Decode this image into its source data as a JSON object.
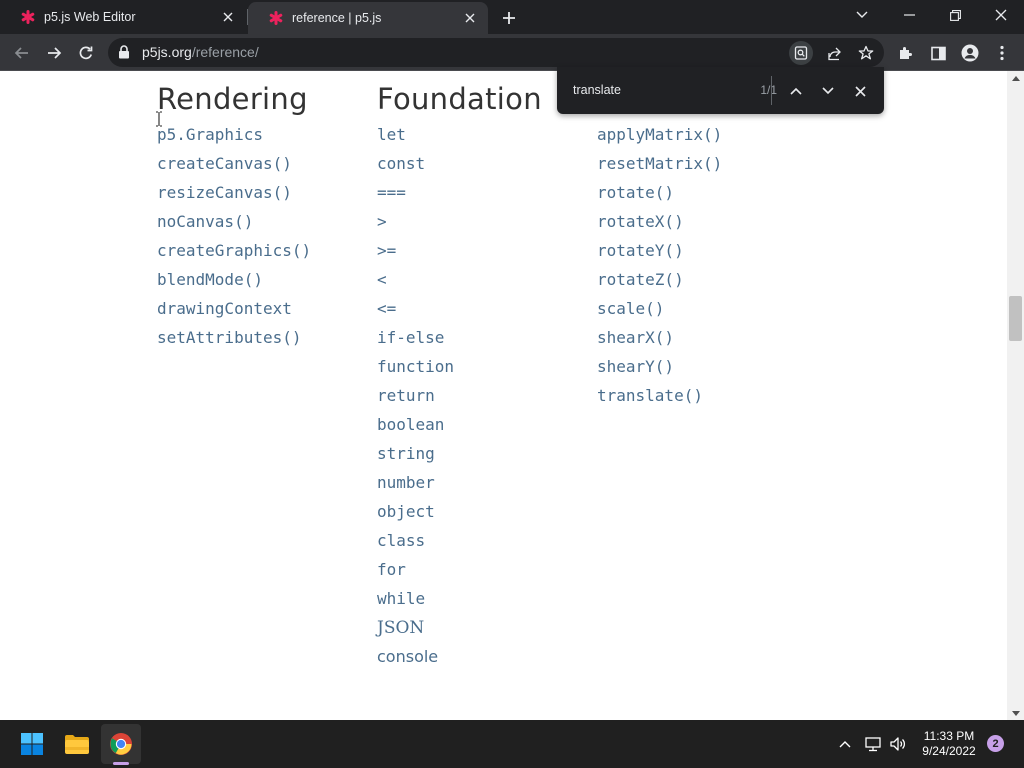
{
  "browser": {
    "tabs": [
      {
        "title": "p5.js Web Editor",
        "active": false,
        "favicon": "p5-asterisk-icon"
      },
      {
        "title": "reference | p5.js",
        "active": true,
        "favicon": "p5-asterisk-icon"
      }
    ],
    "url": {
      "domain": "p5js.org",
      "path": "/reference/"
    },
    "accent": "#ed225d"
  },
  "find_bar": {
    "query": "translate",
    "count": "1/1"
  },
  "page": {
    "columns": [
      {
        "heading": "Rendering",
        "items": [
          "p5.Graphics",
          "createCanvas()",
          "resizeCanvas()",
          "noCanvas()",
          "createGraphics()",
          "blendMode()",
          "drawingContext",
          "setAttributes()"
        ]
      },
      {
        "heading": "Foundation",
        "items": [
          "let",
          "const",
          "===",
          ">",
          ">=",
          "<",
          "<=",
          "if-else",
          "function",
          "return",
          "boolean",
          "string",
          "number",
          "object",
          "class",
          "for",
          "while",
          "JSON",
          "console"
        ]
      },
      {
        "heading": "",
        "items": [
          "applyMatrix()",
          "resetMatrix()",
          "rotate()",
          "rotateX()",
          "rotateY()",
          "rotateZ()",
          "scale()",
          "shearX()",
          "shearY()",
          "translate()"
        ]
      }
    ],
    "link_color": "#4a6d8c"
  },
  "taskbar": {
    "time": "11:33 PM",
    "date": "9/24/2022",
    "notifications": "2"
  }
}
